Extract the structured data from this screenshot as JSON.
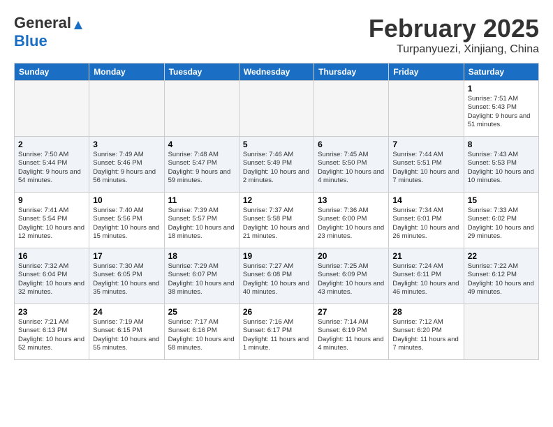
{
  "logo": {
    "general": "General",
    "blue": "Blue"
  },
  "title": {
    "month": "February 2025",
    "location": "Turpanyuezi, Xinjiang, China"
  },
  "days": {
    "headers": [
      "Sunday",
      "Monday",
      "Tuesday",
      "Wednesday",
      "Thursday",
      "Friday",
      "Saturday"
    ]
  },
  "weeks": [
    {
      "cells": [
        {
          "day": "",
          "info": ""
        },
        {
          "day": "",
          "info": ""
        },
        {
          "day": "",
          "info": ""
        },
        {
          "day": "",
          "info": ""
        },
        {
          "day": "",
          "info": ""
        },
        {
          "day": "",
          "info": ""
        },
        {
          "day": "1",
          "info": "Sunrise: 7:51 AM\nSunset: 5:43 PM\nDaylight: 9 hours and 51 minutes."
        }
      ]
    },
    {
      "cells": [
        {
          "day": "2",
          "info": "Sunrise: 7:50 AM\nSunset: 5:44 PM\nDaylight: 9 hours and 54 minutes."
        },
        {
          "day": "3",
          "info": "Sunrise: 7:49 AM\nSunset: 5:46 PM\nDaylight: 9 hours and 56 minutes."
        },
        {
          "day": "4",
          "info": "Sunrise: 7:48 AM\nSunset: 5:47 PM\nDaylight: 9 hours and 59 minutes."
        },
        {
          "day": "5",
          "info": "Sunrise: 7:46 AM\nSunset: 5:49 PM\nDaylight: 10 hours and 2 minutes."
        },
        {
          "day": "6",
          "info": "Sunrise: 7:45 AM\nSunset: 5:50 PM\nDaylight: 10 hours and 4 minutes."
        },
        {
          "day": "7",
          "info": "Sunrise: 7:44 AM\nSunset: 5:51 PM\nDaylight: 10 hours and 7 minutes."
        },
        {
          "day": "8",
          "info": "Sunrise: 7:43 AM\nSunset: 5:53 PM\nDaylight: 10 hours and 10 minutes."
        }
      ]
    },
    {
      "cells": [
        {
          "day": "9",
          "info": "Sunrise: 7:41 AM\nSunset: 5:54 PM\nDaylight: 10 hours and 12 minutes."
        },
        {
          "day": "10",
          "info": "Sunrise: 7:40 AM\nSunset: 5:56 PM\nDaylight: 10 hours and 15 minutes."
        },
        {
          "day": "11",
          "info": "Sunrise: 7:39 AM\nSunset: 5:57 PM\nDaylight: 10 hours and 18 minutes."
        },
        {
          "day": "12",
          "info": "Sunrise: 7:37 AM\nSunset: 5:58 PM\nDaylight: 10 hours and 21 minutes."
        },
        {
          "day": "13",
          "info": "Sunrise: 7:36 AM\nSunset: 6:00 PM\nDaylight: 10 hours and 23 minutes."
        },
        {
          "day": "14",
          "info": "Sunrise: 7:34 AM\nSunset: 6:01 PM\nDaylight: 10 hours and 26 minutes."
        },
        {
          "day": "15",
          "info": "Sunrise: 7:33 AM\nSunset: 6:02 PM\nDaylight: 10 hours and 29 minutes."
        }
      ]
    },
    {
      "cells": [
        {
          "day": "16",
          "info": "Sunrise: 7:32 AM\nSunset: 6:04 PM\nDaylight: 10 hours and 32 minutes."
        },
        {
          "day": "17",
          "info": "Sunrise: 7:30 AM\nSunset: 6:05 PM\nDaylight: 10 hours and 35 minutes."
        },
        {
          "day": "18",
          "info": "Sunrise: 7:29 AM\nSunset: 6:07 PM\nDaylight: 10 hours and 38 minutes."
        },
        {
          "day": "19",
          "info": "Sunrise: 7:27 AM\nSunset: 6:08 PM\nDaylight: 10 hours and 40 minutes."
        },
        {
          "day": "20",
          "info": "Sunrise: 7:25 AM\nSunset: 6:09 PM\nDaylight: 10 hours and 43 minutes."
        },
        {
          "day": "21",
          "info": "Sunrise: 7:24 AM\nSunset: 6:11 PM\nDaylight: 10 hours and 46 minutes."
        },
        {
          "day": "22",
          "info": "Sunrise: 7:22 AM\nSunset: 6:12 PM\nDaylight: 10 hours and 49 minutes."
        }
      ]
    },
    {
      "cells": [
        {
          "day": "23",
          "info": "Sunrise: 7:21 AM\nSunset: 6:13 PM\nDaylight: 10 hours and 52 minutes."
        },
        {
          "day": "24",
          "info": "Sunrise: 7:19 AM\nSunset: 6:15 PM\nDaylight: 10 hours and 55 minutes."
        },
        {
          "day": "25",
          "info": "Sunrise: 7:17 AM\nSunset: 6:16 PM\nDaylight: 10 hours and 58 minutes."
        },
        {
          "day": "26",
          "info": "Sunrise: 7:16 AM\nSunset: 6:17 PM\nDaylight: 11 hours and 1 minute."
        },
        {
          "day": "27",
          "info": "Sunrise: 7:14 AM\nSunset: 6:19 PM\nDaylight: 11 hours and 4 minutes."
        },
        {
          "day": "28",
          "info": "Sunrise: 7:12 AM\nSunset: 6:20 PM\nDaylight: 11 hours and 7 minutes."
        },
        {
          "day": "",
          "info": ""
        }
      ]
    }
  ]
}
